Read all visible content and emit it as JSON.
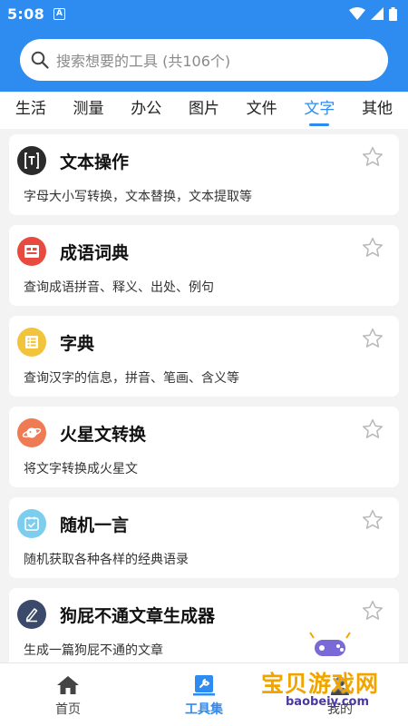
{
  "status_bar": {
    "time": "5:08",
    "notification_letter": "A"
  },
  "search": {
    "placeholder": "搜索想要的工具 (共106个)"
  },
  "tabs": [
    {
      "label": "生活",
      "active": false
    },
    {
      "label": "测量",
      "active": false
    },
    {
      "label": "办公",
      "active": false
    },
    {
      "label": "图片",
      "active": false
    },
    {
      "label": "文件",
      "active": false
    },
    {
      "label": "文字",
      "active": true
    },
    {
      "label": "其他",
      "active": false
    }
  ],
  "tools": [
    {
      "title": "文本操作",
      "desc": "字母大小写转换，文本替换，文本提取等",
      "icon": "text-bracket-icon",
      "icon_color": "#2b2b2b"
    },
    {
      "title": "成语词典",
      "desc": "查询成语拼音、释义、出处、例句",
      "icon": "idiom-book-icon",
      "icon_color": "#e94a3f"
    },
    {
      "title": "字典",
      "desc": "查询汉字的信息，拼音、笔画、含义等",
      "icon": "dictionary-icon",
      "icon_color": "#f2c43c"
    },
    {
      "title": "火星文转换",
      "desc": "将文字转换成火星文",
      "icon": "planet-icon",
      "icon_color": "#ef7b55"
    },
    {
      "title": "随机一言",
      "desc": "随机获取各种各样的经典语录",
      "icon": "calendar-check-icon",
      "icon_color": "#7ccdee"
    },
    {
      "title": "狗屁不通文章生成器",
      "desc": "生成一篇狗屁不通的文章",
      "icon": "pen-write-icon",
      "icon_color": "#3b4a6b"
    }
  ],
  "bottom_nav": [
    {
      "label": "首页",
      "icon": "home-icon",
      "active": false
    },
    {
      "label": "工具集",
      "icon": "toolbox-icon",
      "active": true
    },
    {
      "label": "我的",
      "icon": "user-icon",
      "active": false
    }
  ],
  "watermark": {
    "text": "宝贝游戏网",
    "url": "baobeiy.com"
  },
  "colors": {
    "accent": "#2e8bf0",
    "background": "#f3f3f3",
    "watermark": "#f0a400"
  }
}
